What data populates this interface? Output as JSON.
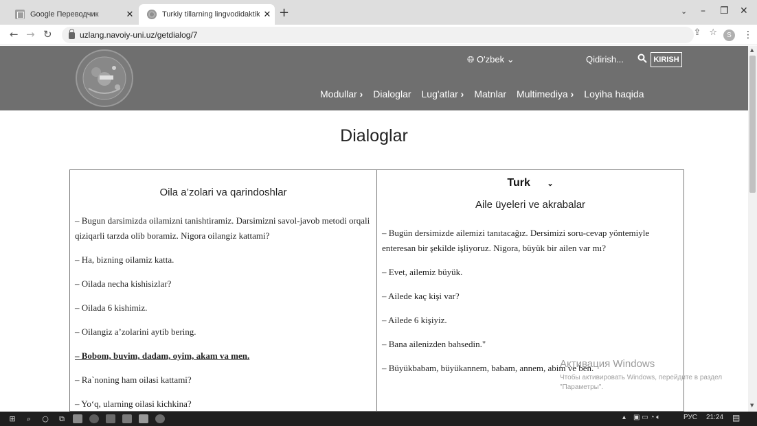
{
  "browser": {
    "tabs": [
      {
        "title": "Google Переводчик",
        "active": false
      },
      {
        "title": "Turkiy tillarning lingvodidaktik el",
        "active": true
      }
    ],
    "url": "uzlang.navoiy-uni.uz/getdialog/7",
    "profile_initial": "S"
  },
  "header": {
    "language": "O'zbek",
    "search_placeholder": "Qidirish...",
    "login_label": "KIRISH",
    "nav": [
      {
        "label": "Modullar",
        "has_chevron": true
      },
      {
        "label": "Dialoglar",
        "has_chevron": false
      },
      {
        "label": "Lug'atlar",
        "has_chevron": true
      },
      {
        "label": "Matnlar",
        "has_chevron": false
      },
      {
        "label": "Multimediya",
        "has_chevron": true
      },
      {
        "label": "Loyiha haqida",
        "has_chevron": false
      }
    ]
  },
  "page": {
    "title": "Dialoglar",
    "left": {
      "heading": "Oila a’zolari va qarindoshlar",
      "lines": [
        "– Bugun darsimizda oilamizni tanishtiramiz. Darsimizni savol-javob metodi orqali qiziqarli tarzda olib boramiz. Nigora oilangiz kattami?",
        "– Ha, bizning oilamiz katta.",
        "– Oilada necha kishisizlar?",
        "– Oilada 6 kishimiz.",
        "– Oilangiz a’zolarini aytib bering.",
        "– Bobom, buvim, dadam, oyim, akam va men.",
        "– Ra`noning ham oilasi kattami?",
        "– Yo‘q, ularning oilasi kichkina?"
      ]
    },
    "right": {
      "language_selected": "Turk",
      "heading": "Aile üyeleri ve akrabalar",
      "lines": [
        "– Bugün dersimizde ailemizi tanıtacağız. Dersimizi soru-cevap yöntemiyle enteresan bir şekilde işliyoruz. Nigora, büyük bir ailen var mı?",
        "– Evet, ailemiz büyük.",
        "– Ailede kaç kişi var?",
        "– Ailede 6 kişiyiz.",
        "– Bana ailenizden bahsedin.\"",
        "– Büyükbabam, büyükannem, babam, annem,  abim ve ben."
      ]
    }
  },
  "watermark": {
    "title": "Активация Windows",
    "subtitle": "Чтобы активировать Windows, перейдите в раздел \"Параметры\"."
  },
  "taskbar": {
    "language": "РУС",
    "time": "21:24"
  }
}
